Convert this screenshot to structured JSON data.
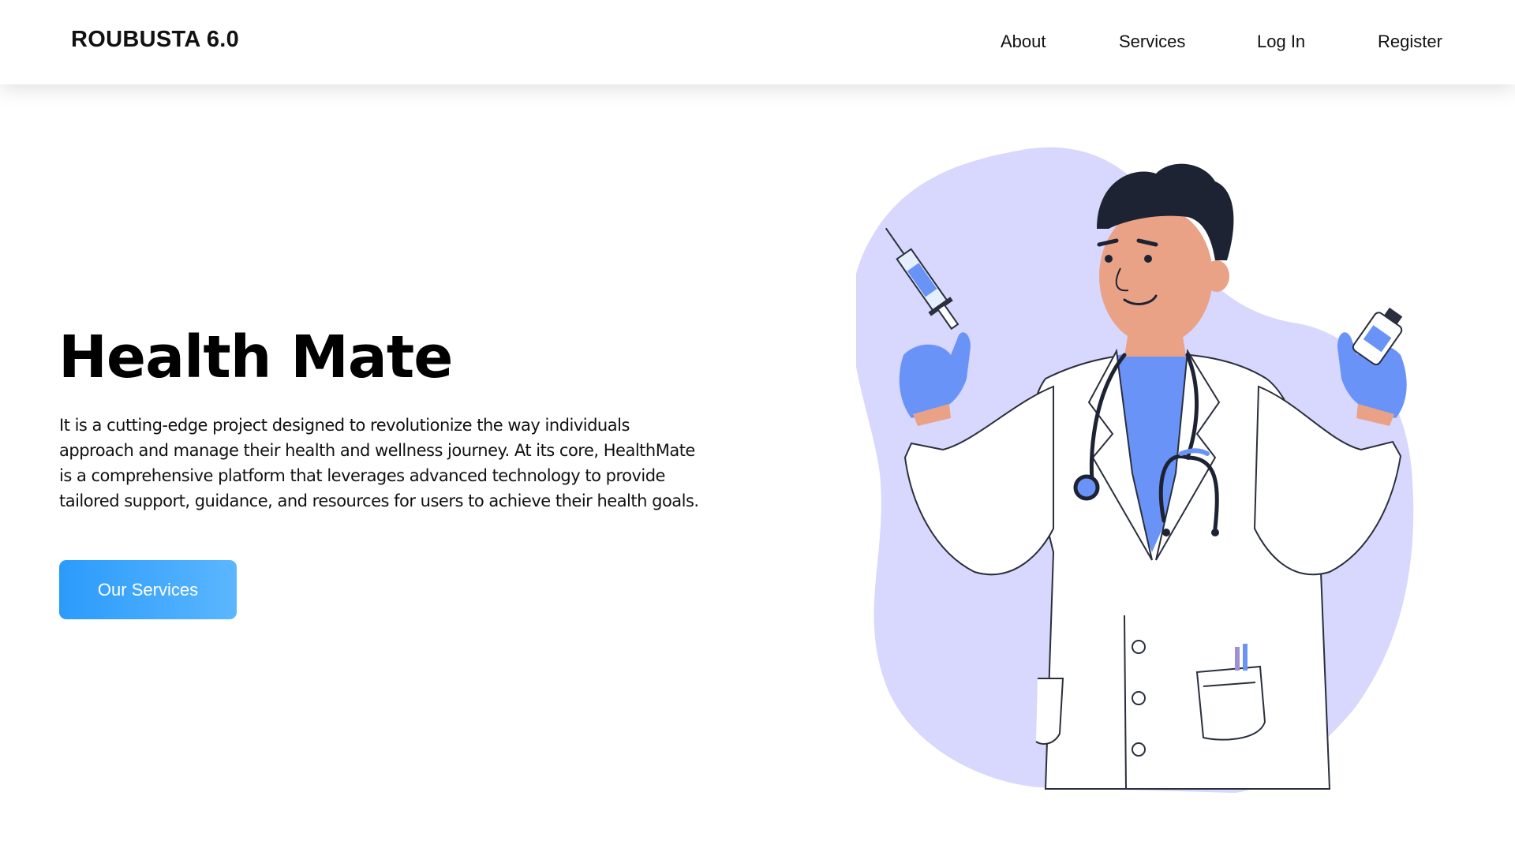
{
  "brand": {
    "name": "ROUBUSTA 6.0"
  },
  "nav": {
    "items": [
      {
        "label": "About"
      },
      {
        "label": "Services"
      },
      {
        "label": "Log In"
      },
      {
        "label": "Register"
      }
    ]
  },
  "hero": {
    "title": "Health Mate",
    "description": "It is a cutting-edge project designed to revolutionize the way individuals approach and manage their health and wellness journey. At its core, HealthMate is a comprehensive platform that leverages advanced technology to provide tailored support, guidance, and resources for users to achieve their health goals.",
    "cta_label": "Our Services"
  },
  "illustration": {
    "icon": "doctor-illustration"
  },
  "colors": {
    "accent": "#2b9bfb",
    "accent_light": "#5bb6ff",
    "blob": "#d8d7fd",
    "glove": "#6a93f8",
    "hair": "#1d2333",
    "skin": "#e9a286"
  }
}
